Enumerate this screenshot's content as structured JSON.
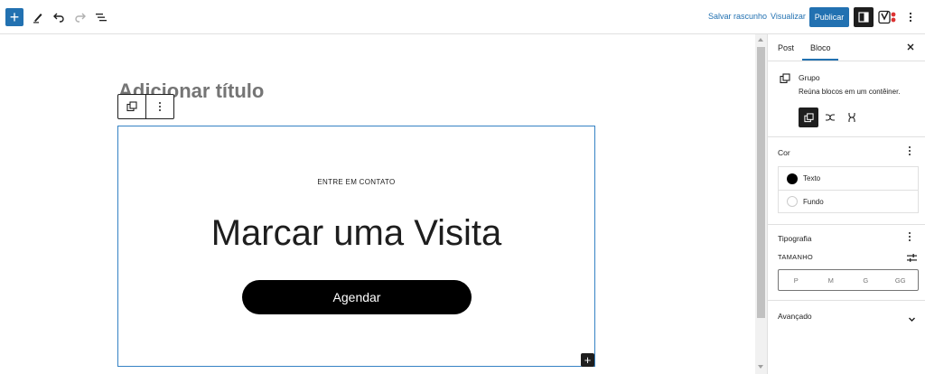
{
  "toolbar": {
    "inserter_icon": "plus-icon",
    "tools_icon": "pencil-icon",
    "undo_icon": "undo-icon",
    "redo_icon": "redo-icon",
    "list_view_icon": "list-view-icon",
    "save_draft": "Salvar rascunho",
    "preview": "Visualizar",
    "publish": "Publicar",
    "settings_icon": "sidebar-toggle-icon",
    "yoast_icon": "yoast-icon",
    "more_icon": "more-vertical-icon"
  },
  "editor": {
    "title_placeholder": "Adicionar título",
    "block_toolbar": {
      "group_icon": "group-icon",
      "options_icon": "more-vertical-icon"
    },
    "group": {
      "kicker": "ENTRE EM CONTATO",
      "heading": "Marcar uma Visita",
      "button": "Agendar"
    },
    "appender_icon": "plus-icon"
  },
  "sidebar": {
    "tabs": [
      "Post",
      "Bloco"
    ],
    "active_tab": "Bloco",
    "close_icon": "close-icon",
    "block_card": {
      "icon": "group-icon",
      "title": "Grupo",
      "description": "Reúna blocos em um contêiner.",
      "variations": [
        "group-icon",
        "row-icon",
        "stack-icon"
      ]
    },
    "color_panel": {
      "title": "Cor",
      "items": [
        {
          "label": "Texto",
          "swatch": "#000000"
        },
        {
          "label": "Fundo",
          "swatch": "#ffffff"
        }
      ]
    },
    "typography_panel": {
      "title": "Tipografia",
      "size_label": "TAMANHO",
      "sizes": [
        "P",
        "M",
        "G",
        "GG"
      ]
    },
    "advanced_panel": {
      "title": "Avançado"
    }
  },
  "colors": {
    "accent": "#2271b1",
    "selection": "#3582c4",
    "dark": "#1e1e1e"
  }
}
